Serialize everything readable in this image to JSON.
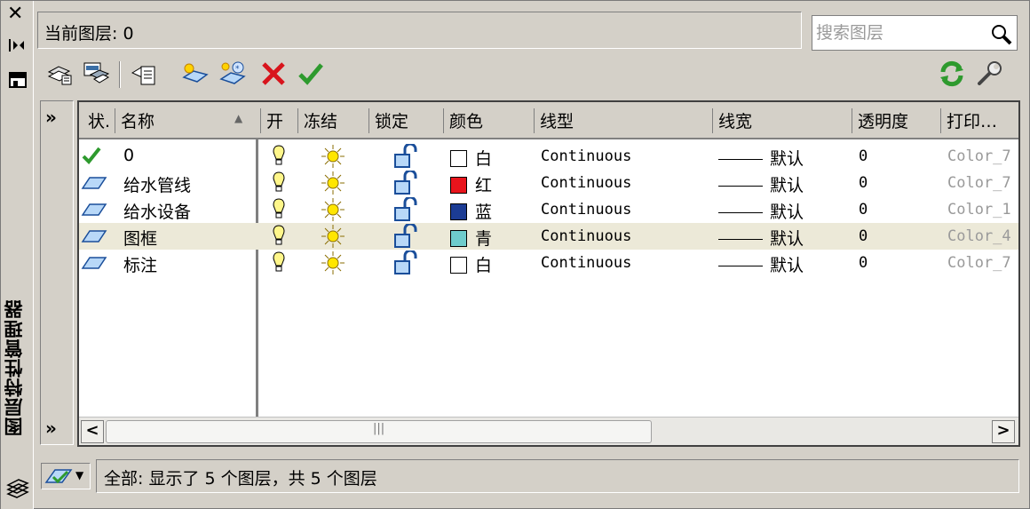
{
  "palette": {
    "title": "图层特性管理器"
  },
  "current_layer": {
    "text": "当前图层: 0"
  },
  "search": {
    "placeholder": "搜索图层"
  },
  "columns": [
    "状.",
    "名称",
    "开",
    "冻结",
    "锁定",
    "颜色",
    "线型",
    "线宽",
    "透明度",
    "打印…"
  ],
  "nav": {
    "expand": "»",
    "collapse": "»"
  },
  "layers": [
    {
      "name": "0",
      "color_name": "白",
      "color": "#ffffff",
      "linetype": "Continuous",
      "lineweight": "默认",
      "transparency": "0",
      "plot_style": "Color_7",
      "current": true
    },
    {
      "name": "给水管线",
      "color_name": "红",
      "color": "#e8141c",
      "linetype": "Continuous",
      "lineweight": "默认",
      "transparency": "0",
      "plot_style": "Color_7",
      "current": false
    },
    {
      "name": "给水设备",
      "color_name": "蓝",
      "color": "#1c3c94",
      "linetype": "Continuous",
      "lineweight": "默认",
      "transparency": "0",
      "plot_style": "Color_1",
      "current": false
    },
    {
      "name": "图框",
      "color_name": "青",
      "color": "#6ecccc",
      "linetype": "Continuous",
      "lineweight": "默认",
      "transparency": "0",
      "plot_style": "Color_4",
      "current": false,
      "selected": true
    },
    {
      "name": "标注",
      "color_name": "白",
      "color": "#ffffff",
      "linetype": "Continuous",
      "lineweight": "默认",
      "transparency": "0",
      "plot_style": "Color_7",
      "current": false
    }
  ],
  "status": {
    "text": "全部: 显示了 5 个图层，共 5 个图层"
  },
  "colors": {
    "accent_green": "#2e9a2e",
    "delete_red": "#d8141c",
    "selected_row": "#ece9d8"
  }
}
